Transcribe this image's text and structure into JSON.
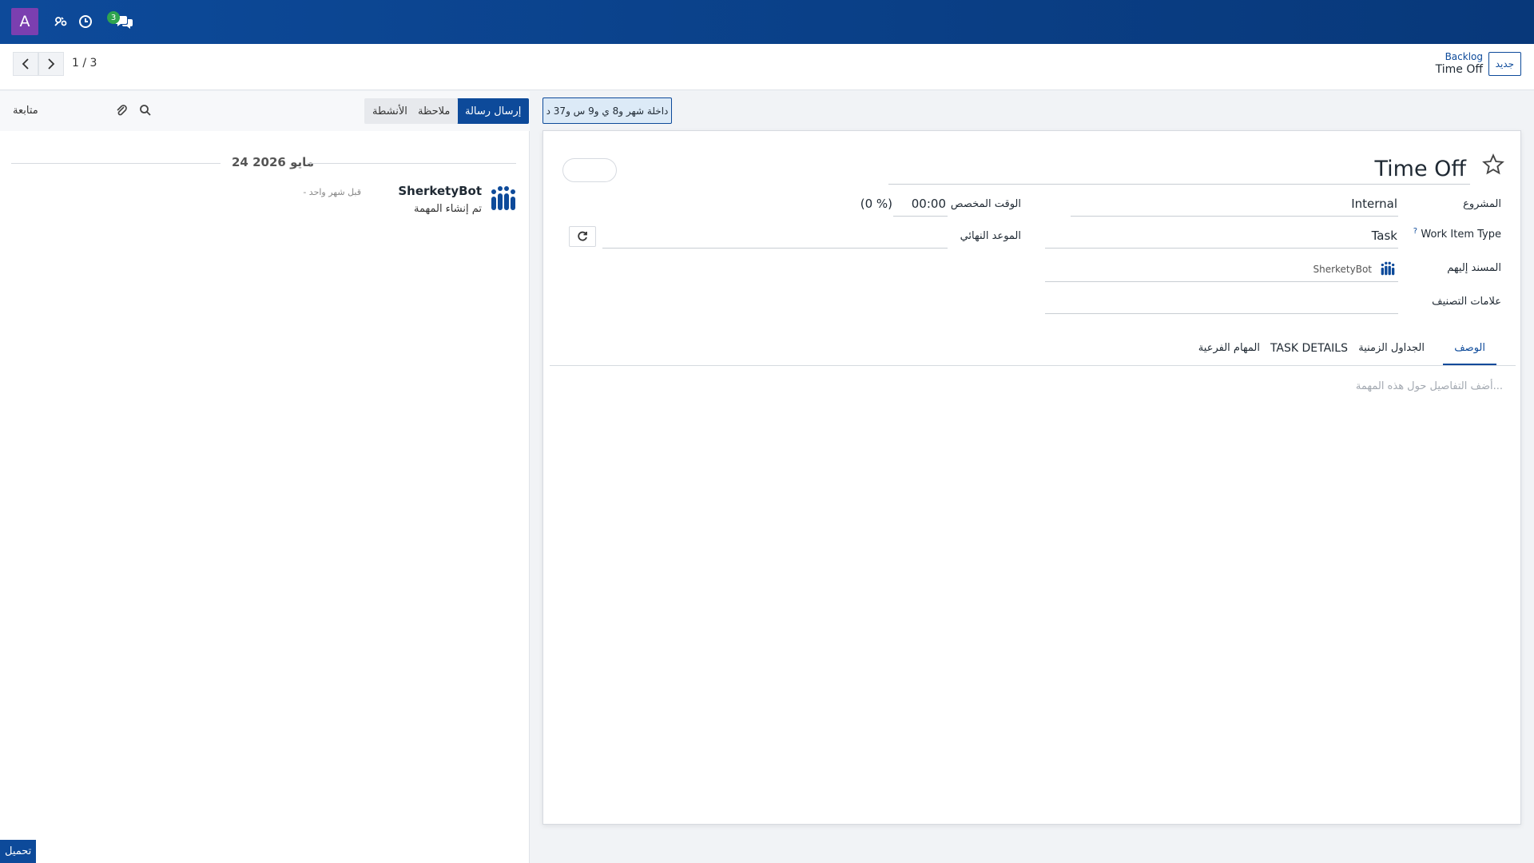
{
  "navbar": {
    "avatar_letter": "A",
    "chat_badge": "3",
    "icons": [
      "tools-icon",
      "clock-icon",
      "chat-icon"
    ]
  },
  "control_panel": {
    "new_button": "جديد",
    "breadcrumb_parent": "Backlog",
    "breadcrumb_current": "Time Off",
    "pager": "1 / 3"
  },
  "chatter": {
    "send_message": "إرسال رسالة",
    "note": "ملاحظة",
    "activities": "الأنشطة",
    "follow": "متابعة",
    "date": "24 مايو 2026",
    "message": {
      "author": "SherketyBot",
      "time": "- قبل شهر واحد",
      "body": "تم إنشاء المهمة"
    }
  },
  "form": {
    "timer": "داخلة  شهر و8 ي و9 س و37 د",
    "title": "Time Off",
    "fields": {
      "project_label": "المشروع",
      "project_value": "Internal",
      "work_item_type_label": "Work Item Type",
      "work_item_type_help": "?",
      "work_item_type_value": "Task",
      "assignees_label": "المسند إليهم",
      "assignees_value": "SherketyBot",
      "tags_label": "علامات التصنيف",
      "allocated_time_label": "الوقت المخصص",
      "allocated_time_value": "00:00",
      "allocated_percent": "(0 %)",
      "deadline_label": "الموعد النهائي"
    },
    "tabs": [
      "الوصف",
      "الجداول الزمنية",
      "TASK DETAILS",
      "المهام الفرعية"
    ],
    "description_placeholder": "أضف التفاصيل حول هذه المهمة..."
  },
  "upload_button": "تحميل",
  "colors": {
    "brand": "#0d4a9a",
    "avatar": "#7b3fb0",
    "badge": "#2fa44f"
  }
}
